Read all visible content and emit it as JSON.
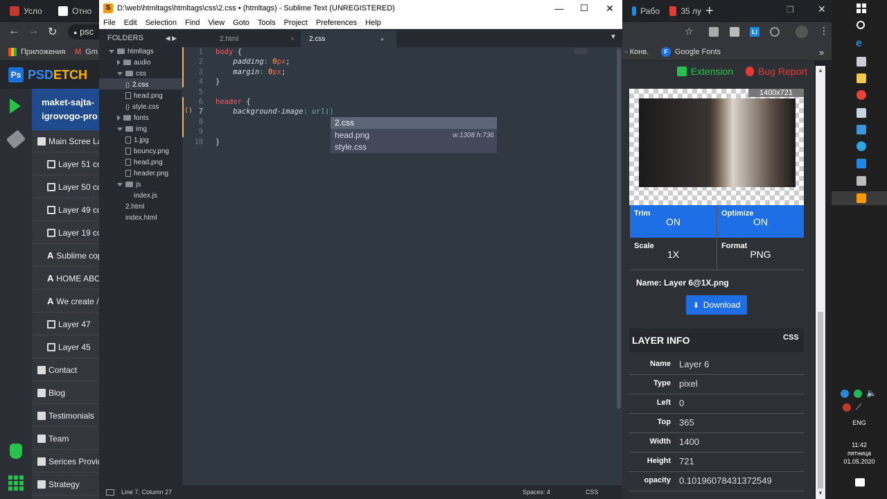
{
  "chrome": {
    "tabs": [
      {
        "label": "Усло",
        "color": "#c0392b"
      },
      {
        "label": "Отно",
        "color": "#ffffff"
      },
      {
        "label": "Рабо",
        "color": "#1e88e5"
      },
      {
        "label": "35 лу",
        "color": "#e53935"
      }
    ],
    "address_prefix": "psc",
    "bookmarks": {
      "apps": "Приложения",
      "gm": "Gm",
      "konv": "- Конв.",
      "fonts": "Google Fonts",
      "more": "»"
    }
  },
  "psd": {
    "logo_letter": "Ps",
    "brand_a": "PSD",
    "brand_b": "ETCH",
    "title_line1": "maket-sajta-",
    "title_line2": "igrovogo-pro",
    "items": [
      {
        "label": "Main Scree La",
        "icon": "folder"
      },
      {
        "label": "Layer 51 co",
        "icon": "image"
      },
      {
        "label": "Layer 50 co",
        "icon": "image"
      },
      {
        "label": "Layer 49 co",
        "icon": "image"
      },
      {
        "label": "Layer 19 co",
        "icon": "image"
      },
      {
        "label": "Sublime cop",
        "icon": "text"
      },
      {
        "label": "HOME ABO",
        "icon": "text"
      },
      {
        "label": "We create /",
        "icon": "text"
      },
      {
        "label": "Layer 47",
        "icon": "image"
      },
      {
        "label": "Layer 45",
        "icon": "image"
      },
      {
        "label": "Contact",
        "icon": "folder"
      },
      {
        "label": "Blog",
        "icon": "folder"
      },
      {
        "label": "Testimonials",
        "icon": "folder"
      },
      {
        "label": "Team",
        "icon": "folder"
      },
      {
        "label": "Serices Provid",
        "icon": "folder"
      },
      {
        "label": "Strategy",
        "icon": "folder"
      }
    ]
  },
  "right": {
    "extension": "Extension",
    "bug_report": "Bug Report",
    "dimensions": "1400x721",
    "trim_label": "Trim",
    "trim_value": "ON",
    "optimize_label": "Optimize",
    "optimize_value": "ON",
    "scale_label": "Scale",
    "scale_value": "1X",
    "format_label": "Format",
    "format_value": "PNG",
    "name_line": "Name: Layer 6@1X.png",
    "download": "Download",
    "layer_info": "LAYER INFO",
    "css": "CSS",
    "rows": [
      {
        "k": "Name",
        "v": "Layer 6"
      },
      {
        "k": "Type",
        "v": "pixel"
      },
      {
        "k": "Left",
        "v": "0"
      },
      {
        "k": "Top",
        "v": "365"
      },
      {
        "k": "Width",
        "v": "1400"
      },
      {
        "k": "Height",
        "v": "721"
      },
      {
        "k": "opacity",
        "v": "0.10196078431372549"
      }
    ],
    "accent": "#1e6fe6"
  },
  "taskbar": {
    "lang": "ENG",
    "time": "11:42",
    "day": "пятница",
    "date": "01.05.2020"
  },
  "sublime": {
    "title": "D:\\web\\htmltags\\htmltags\\css\\2.css • (htmltags) - Sublime Text (UNREGISTERED)",
    "menu": [
      "File",
      "Edit",
      "Selection",
      "Find",
      "View",
      "Goto",
      "Tools",
      "Project",
      "Preferences",
      "Help"
    ],
    "folders_label": "FOLDERS",
    "tree": [
      {
        "label": "htmltags",
        "kind": "folder-open",
        "depth": 0
      },
      {
        "label": "audio",
        "kind": "folder-closed",
        "depth": 1
      },
      {
        "label": "css",
        "kind": "folder-open",
        "depth": 1
      },
      {
        "label": "2.css",
        "kind": "css",
        "depth": 2
      },
      {
        "label": "head.png",
        "kind": "file",
        "depth": 2
      },
      {
        "label": "style.css",
        "kind": "css",
        "depth": 2
      },
      {
        "label": "fonts",
        "kind": "folder-closed",
        "depth": 1
      },
      {
        "label": "img",
        "kind": "folder-open",
        "depth": 1
      },
      {
        "label": "1.jpg",
        "kind": "file",
        "depth": 2
      },
      {
        "label": "bouncy.png",
        "kind": "file",
        "depth": 2
      },
      {
        "label": "head.png",
        "kind": "file",
        "depth": 2
      },
      {
        "label": "header.png",
        "kind": "file",
        "depth": 2
      },
      {
        "label": "js",
        "kind": "folder-open",
        "depth": 1
      },
      {
        "label": "index.js",
        "kind": "plain",
        "depth": 2
      },
      {
        "label": "2.html",
        "kind": "plain",
        "depth": 1
      },
      {
        "label": "index.html",
        "kind": "plain",
        "depth": 1
      }
    ],
    "tabs": [
      {
        "label": "2.html",
        "close": "×"
      },
      {
        "label": "2.css",
        "close": "●"
      }
    ],
    "line_numbers": [
      "1",
      "2",
      "3",
      "4",
      "5",
      "6",
      "7",
      "8",
      "9",
      "10"
    ],
    "code": {
      "l1_sel": "body",
      "l2_prop": "padding",
      "l2_val": "0",
      "l3_prop": "margin",
      "l3_val": "0",
      "unit": "px",
      "l6_sel": "header",
      "l7_prop": "background-image",
      "l7_fn": "url"
    },
    "autocomplete": [
      {
        "label": "2.css",
        "hint": ""
      },
      {
        "label": "head.png",
        "hint": "w:1308 h:736"
      },
      {
        "label": "style.css",
        "hint": ""
      }
    ],
    "status_left": "Line 7, Column 27",
    "status_spaces": "Spaces: 4",
    "status_syntax": "CSS"
  }
}
